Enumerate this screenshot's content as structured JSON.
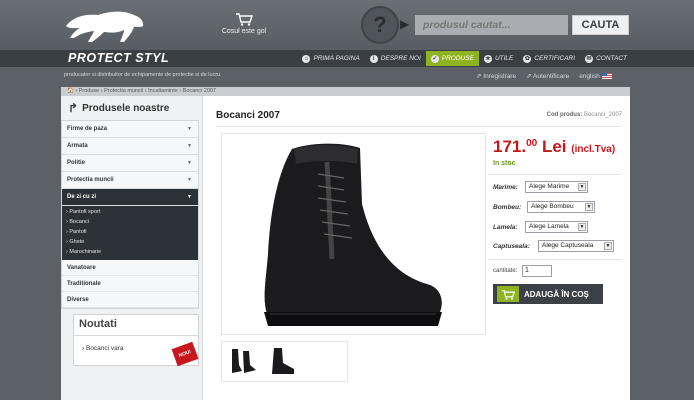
{
  "header": {
    "brand": "PROTECT STYL",
    "cart_label": "Cosul este gol",
    "search_placeholder": "produsul cautat...",
    "search_button": "CAUTA",
    "search_help": "?"
  },
  "nav": [
    {
      "label": "PRIMA PAGINA",
      "icon": "home-icon",
      "glyph": "⌂"
    },
    {
      "label": "DESPRE NOI",
      "icon": "info-icon",
      "glyph": "i"
    },
    {
      "label": "PRODUSE",
      "icon": "tag-icon",
      "glyph": "✓",
      "active": true
    },
    {
      "label": "UTILE",
      "icon": "star-icon",
      "glyph": "★"
    },
    {
      "label": "CERTIFICARI",
      "icon": "ribbon-icon",
      "glyph": "✿"
    },
    {
      "label": "CONTACT",
      "icon": "mail-icon",
      "glyph": "✉"
    }
  ],
  "tagline": "producator si distribuitor de echipamente de protectie si de lucru",
  "user": {
    "register": "Inregistrare",
    "login": "Autentificare",
    "language": "english"
  },
  "breadcrumb": "🏠 › Produse › Protectia muncii › Incaltaminte › Bocanci 2007",
  "sidebar": {
    "title": "Produsele noastre",
    "categories": [
      {
        "label": "Firme de paza"
      },
      {
        "label": "Armata"
      },
      {
        "label": "Politie"
      },
      {
        "label": "Protectia muncii"
      },
      {
        "label": "De zi cu zi"
      }
    ],
    "subitems": [
      "Pantofi sport",
      "Bocanci",
      "Pantofi",
      "Ghete",
      "Marochinarie"
    ],
    "extra": [
      "Vanatoare",
      "Traditionale",
      "Diverse"
    ],
    "news_title": "Noutati",
    "news_item": "› Bocanci vara",
    "news_badge": "NOU!"
  },
  "product": {
    "title": "Bocanci 2007",
    "code_label": "Cod produs:",
    "code_value": "Bocanci_2007",
    "price_int": "171.",
    "price_dec": "00",
    "currency": "Lei",
    "tva": "(incl.Tva)",
    "stock": "In stoc",
    "options": [
      {
        "label": "Marime:",
        "value": "Alege Marime"
      },
      {
        "label": "Bombeu:",
        "value": "Alege Bombeu"
      },
      {
        "label": "Lamela:",
        "value": "Alege Lamela"
      },
      {
        "label": "Captuseala:",
        "value": "Alege Captuseala"
      }
    ],
    "qty_label": "cantitate:",
    "qty_value": "1",
    "add_to_cart": "ADAUGĂ ÎN COŞ"
  },
  "colors": {
    "accent_green": "#8fb320",
    "price_red": "#c8161d",
    "dark": "#2c3237"
  }
}
